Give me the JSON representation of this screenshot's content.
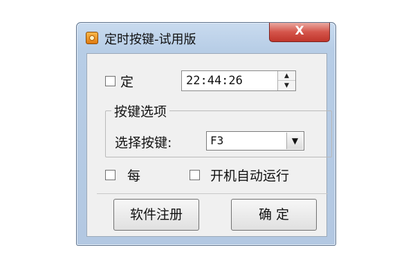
{
  "window": {
    "title": "定时按键-试用版",
    "app_icon": "timer-app-icon",
    "close_label": "X"
  },
  "timer": {
    "enable_label": "定",
    "enabled": false,
    "time_value": "22:44:26",
    "spinner_up": "▲",
    "spinner_down": "▼"
  },
  "key_group": {
    "title": "按键选项",
    "select_label": "选择按键:",
    "selected_key": "F3",
    "dropdown_arrow": "▼"
  },
  "options": {
    "repeat_label": "每",
    "repeat_checked": false,
    "autostart_label": "开机自动运行",
    "autostart_checked": false
  },
  "buttons": {
    "register_label": "软件注册",
    "ok_label": "确 定"
  }
}
